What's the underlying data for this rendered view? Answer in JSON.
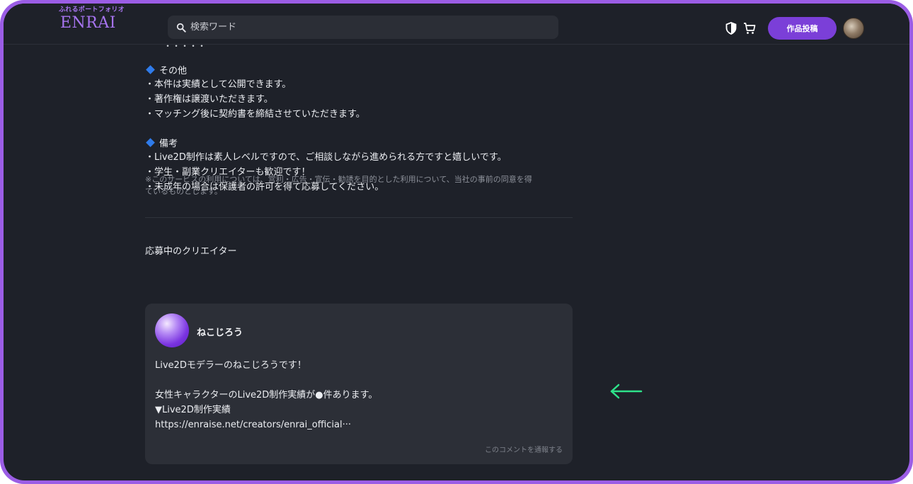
{
  "brand": {
    "tagline": "ふれるポートフォリオ",
    "name": "ENRAI"
  },
  "search": {
    "placeholder": "検索ワード"
  },
  "header": {
    "post_button": "作品投稿"
  },
  "sections": {
    "other": {
      "title": "その他",
      "lines": [
        "・本件は実績として公開できます。",
        "・著作権は譲渡いただきます。",
        "・マッチング後に契約書を締結させていただきます。"
      ]
    },
    "remarks": {
      "title": "備考",
      "lines": [
        "・Live2D制作は素人レベルですので、ご相談しながら進められる方ですと嬉しいです。",
        "・学生・副業クリエイターも歓迎です！",
        "・未成年の場合は保護者の許可を得て応募してください。"
      ]
    }
  },
  "notice": {
    "line1": "※このサービスの利用については、営利・広告・宣伝・勧誘を目的とした利用について、当社の事前の同意を得",
    "line2": "ているものとします。"
  },
  "applicants": {
    "title": "応募中のクリエイター",
    "items": [
      {
        "name": "ねこじろう",
        "body": {
          "line1": "Live2Dモデラーのねこじろうです！",
          "line2": "",
          "line3": "女性キャラクターのLive2D制作実績が●件あります。",
          "line4": "▼Live2D制作実績",
          "line5": "https://enraise.net/creators/enrai_official···"
        },
        "report_label": "このコメントを通報する"
      }
    ]
  },
  "colors": {
    "accent": "#7b3fd8",
    "frame": "#9b5de5",
    "background": "#1e2129",
    "card": "#2c2f37",
    "diamond": "#2f7bea",
    "annotation_arrow": "#2ee28a"
  }
}
